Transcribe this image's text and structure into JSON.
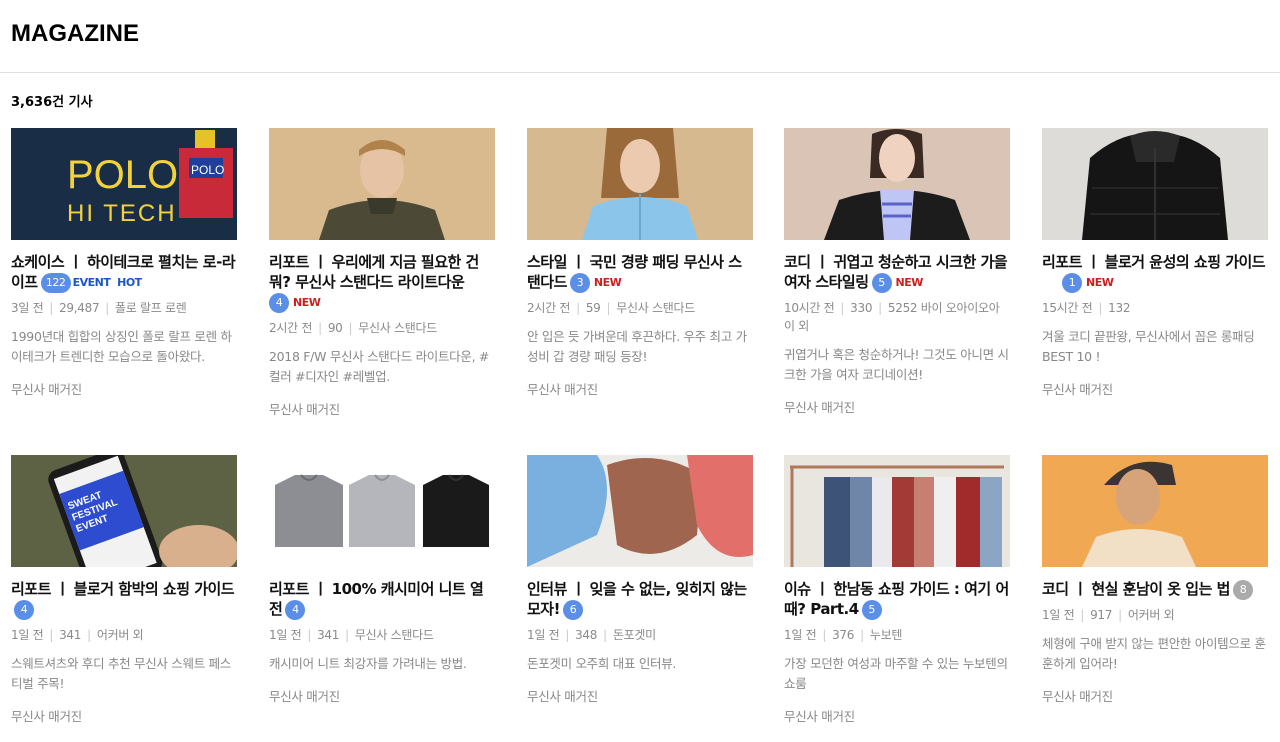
{
  "page": {
    "title": "MAGAZINE",
    "article_count": "3,636건 기사"
  },
  "colors": {
    "badge": "#5b8ee6",
    "badge_grey": "#aaaaaa",
    "new": "#cc1f1f",
    "event": "#1a56c7"
  },
  "articles": [
    {
      "title": "쇼케이스 ㅣ 하이테크로 펼치는 로-라이프",
      "comments": "122",
      "tags": [
        "EVENT",
        "HOT"
      ],
      "new": "",
      "meta": [
        "3일 전",
        "29,487",
        "폴로 랄프 로렌"
      ],
      "desc": "1990년대 힙합의 상징인 폴로 랄프 로렌 하이테크가 트렌디한 모습으로 돌아왔다.",
      "source": "무신사 매거진",
      "image": "polo-hi-tech-banner",
      "image_text": [
        "POLO",
        "HI TECH",
        "POLO"
      ]
    },
    {
      "title": "리포트 ㅣ 우리에게 지금 필요한 건 뭐? 무신사 스탠다드 라이트다운",
      "comments": "4",
      "new": "NEW",
      "meta": [
        "2시간 전",
        "90",
        "무신사 스탠다드"
      ],
      "desc": "2018 F/W 무신사 스탠다드 라이트다운, #컬러 #디자인 #레벨업.",
      "source": "무신사 매거진",
      "image": "man-light-down-jacket"
    },
    {
      "title": "스타일 ㅣ 국민 경량 패딩 무신사 스탠다드",
      "comments": "3",
      "new": "NEW",
      "meta": [
        "2시간 전",
        "59",
        "무신사 스탠다드"
      ],
      "desc": "안 입은 듯 가벼운데 후끈하다. 우주 최고 가성비 갑 경량 패딩 등장!",
      "source": "무신사 매거진",
      "image": "woman-blue-padding"
    },
    {
      "title": "코디 ㅣ 귀엽고 청순하고 시크한 가을 여자 스타일링",
      "comments": "5",
      "new": "NEW",
      "meta": [
        "10시간 전",
        "330",
        "5252 바이 오아이오아이 외"
      ],
      "desc": "귀엽거나 혹은 청순하거나! 그것도 아니면 시크한 가을 여자 코디네이션!",
      "source": "무신사 매거진",
      "image": "woman-leather-jacket"
    },
    {
      "title": "리포트 ㅣ 블로거 윤성의 쇼핑 가이드",
      "comments": "1",
      "new": "NEW",
      "meta": [
        "15시간 전",
        "132"
      ],
      "desc": "겨울 코디 끝판왕, 무신사에서 꼽은 롱패딩 BEST 10 !",
      "source": "무신사 매거진",
      "image": "black-long-padding"
    },
    {
      "title": "리포트 ㅣ 블로거 함박의 쇼핑 가이드",
      "comments": "4",
      "new": "",
      "meta": [
        "1일 전",
        "341",
        "어커버 외"
      ],
      "desc": "스웨트셔츠와 후디 추천 무신사 스웨트 페스티벌 주목!",
      "source": "무신사 매거진",
      "image": "phone-sweat-festival",
      "image_text": [
        "SWEAT",
        "FESTIVAL",
        "EVENT"
      ]
    },
    {
      "title": "리포트 ㅣ 100% 캐시미어 니트 열전",
      "comments": "4",
      "new": "",
      "meta": [
        "1일 전",
        "341",
        "무신사 스탠다드"
      ],
      "desc": "캐시미어 니트 최강자를 가려내는 방법.",
      "source": "무신사 매거진",
      "image": "three-knit-sweaters"
    },
    {
      "title": "인터뷰 ㅣ 잊을 수 없는, 잊히지 않는 모자!",
      "comments": "6",
      "new": "",
      "meta": [
        "1일 전",
        "348",
        "돈포겟미"
      ],
      "desc": "돈포겟미 오주희 대표 인터뷰.",
      "source": "무신사 매거진",
      "image": "colored-caps"
    },
    {
      "title": "이슈 ㅣ 한남동 쇼핑 가이드 : 여기 어때? Part.4",
      "comments": "5",
      "new": "",
      "meta": [
        "1일 전",
        "376",
        "누보텐"
      ],
      "desc": "가장 모던한 여성과 마주할 수 있는 누보텐의 쇼룸",
      "source": "무신사 매거진",
      "image": "clothing-rack-showroom"
    },
    {
      "title": "코디 ㅣ 현실 훈남이 옷 입는 법",
      "comments": "8",
      "new": "",
      "meta": [
        "1일 전",
        "917",
        "어커버 외"
      ],
      "desc": "체형에 구애 받지 않는 편안한 아이템으로 훈훈하게 입어라!",
      "source": "무신사 매거진",
      "image": "man-snapback-orange"
    }
  ]
}
